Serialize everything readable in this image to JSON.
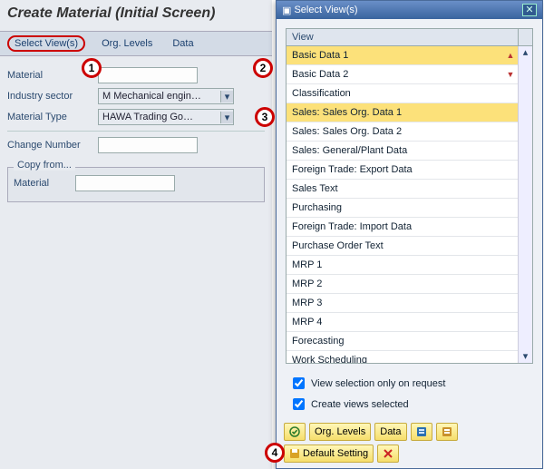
{
  "main": {
    "title": "Create Material (Initial Screen)",
    "tabs": {
      "select_views": "Select View(s)",
      "org_levels": "Org. Levels",
      "data": "Data"
    },
    "fields": {
      "material_label": "Material",
      "industry_label": "Industry sector",
      "industry_value": "M Mechanical engin…",
      "mattype_label": "Material Type",
      "mattype_value": "HAWA Trading Go…",
      "change_label": "Change Number"
    },
    "copy": {
      "title": "Copy from...",
      "material_label": "Material"
    }
  },
  "dialog": {
    "title": "Select View(s)",
    "col_header": "View",
    "items": [
      {
        "label": "Basic Data 1",
        "selected": true
      },
      {
        "label": "Basic Data 2",
        "selected": false
      },
      {
        "label": "Classification",
        "selected": false
      },
      {
        "label": "Sales: Sales Org. Data 1",
        "selected": true
      },
      {
        "label": "Sales: Sales Org. Data 2",
        "selected": false
      },
      {
        "label": "Sales: General/Plant Data",
        "selected": false
      },
      {
        "label": "Foreign Trade: Export Data",
        "selected": false
      },
      {
        "label": "Sales Text",
        "selected": false
      },
      {
        "label": "Purchasing",
        "selected": false
      },
      {
        "label": "Foreign Trade: Import Data",
        "selected": false
      },
      {
        "label": "Purchase Order Text",
        "selected": false
      },
      {
        "label": "MRP 1",
        "selected": false
      },
      {
        "label": "MRP 2",
        "selected": false
      },
      {
        "label": "MRP 3",
        "selected": false
      },
      {
        "label": "MRP 4",
        "selected": false
      },
      {
        "label": "Forecasting",
        "selected": false
      },
      {
        "label": "Work Scheduling",
        "selected": false
      }
    ],
    "chk1": "View selection only on request",
    "chk2": "Create views selected",
    "buttons": {
      "org_levels": "Org. Levels",
      "data": "Data",
      "default": "Default Setting"
    }
  },
  "badges": {
    "b1": "1",
    "b2": "2",
    "b3": "3",
    "b4": "4"
  }
}
